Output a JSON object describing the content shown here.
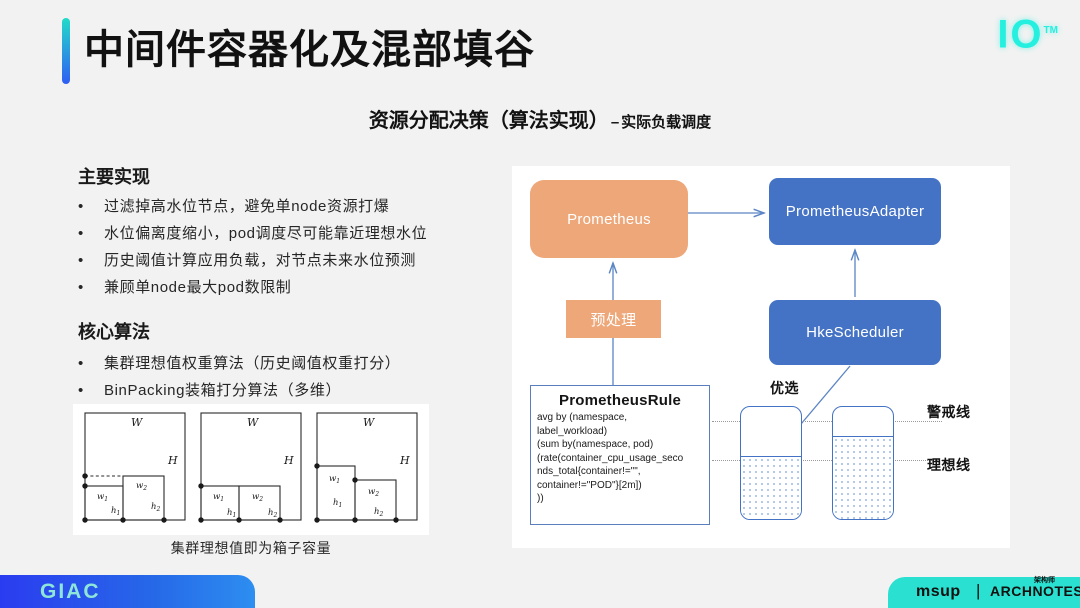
{
  "slide": {
    "title": "中间件容器化及混部填谷",
    "subtitle_main": "资源分配决策（算法实现）",
    "subtitle_dash": "–",
    "subtitle_secondary": "实际负载调度",
    "logo_top_right": "IO",
    "logo_top_right_tm": "TM",
    "accent_color_top": "#23dbc9",
    "accent_color_bottom": "#2f5df3"
  },
  "left": {
    "section_main": {
      "heading": "主要实现",
      "bullet_marker": "•",
      "items": [
        "过滤掉高水位节点，避免单node资源打爆",
        "水位偏离度缩小，pod调度尽可能靠近理想水位",
        "历史阈值计算应用负载，对节点未来水位预测",
        "兼顾单node最大pod数限制"
      ]
    },
    "section_algo": {
      "heading": "核心算法",
      "bullet_marker": "•",
      "items": [
        "集群理想值权重算法（历史阈值权重打分）",
        "BinPacking装箱打分算法（多维）"
      ]
    },
    "binpack_figure": {
      "caption": "集群理想值即为箱子容量",
      "labels": {
        "bin_width": "W",
        "bin_height": "H",
        "item1_width": "w",
        "item1_width_sub": "1",
        "item1_height": "h",
        "item1_height_sub": "1",
        "item2_width": "w",
        "item2_width_sub": "2",
        "item2_height": "h",
        "item2_height_sub": "2"
      }
    }
  },
  "diagram": {
    "nodes": {
      "prometheus": "Prometheus",
      "prometheus_adapter": "PrometheusAdapter",
      "hke_scheduler": "HkeScheduler",
      "preprocess": "预处理",
      "prometheus_rule_title": "PrometheusRule"
    },
    "prometheus_rule_code": "avg by (namespace,\nlabel_workload)\n(sum by(namespace, pod)\n(rate(container_cpu_usage_seco\nnds_total{container!=\"\",\ncontainer!=\"POD\"}[2m])\n))",
    "labels": {
      "preferred": "优选",
      "warning_line": "警戒线",
      "ideal_line": "理想线"
    },
    "colors": {
      "orange": "#eda779",
      "blue": "#4472c4",
      "arrow": "#5b85c4"
    },
    "capacity_bars": [
      {
        "name": "bar-left",
        "fill_percent": 56
      },
      {
        "name": "bar-right",
        "fill_percent": 74
      }
    ]
  },
  "footer": {
    "left_logo": "GIAC",
    "right_logo_primary": "msup",
    "right_logo_separator": "|",
    "right_logo_secondary": "ARCHNOTES",
    "right_logo_secondary_cn": "架构师"
  }
}
